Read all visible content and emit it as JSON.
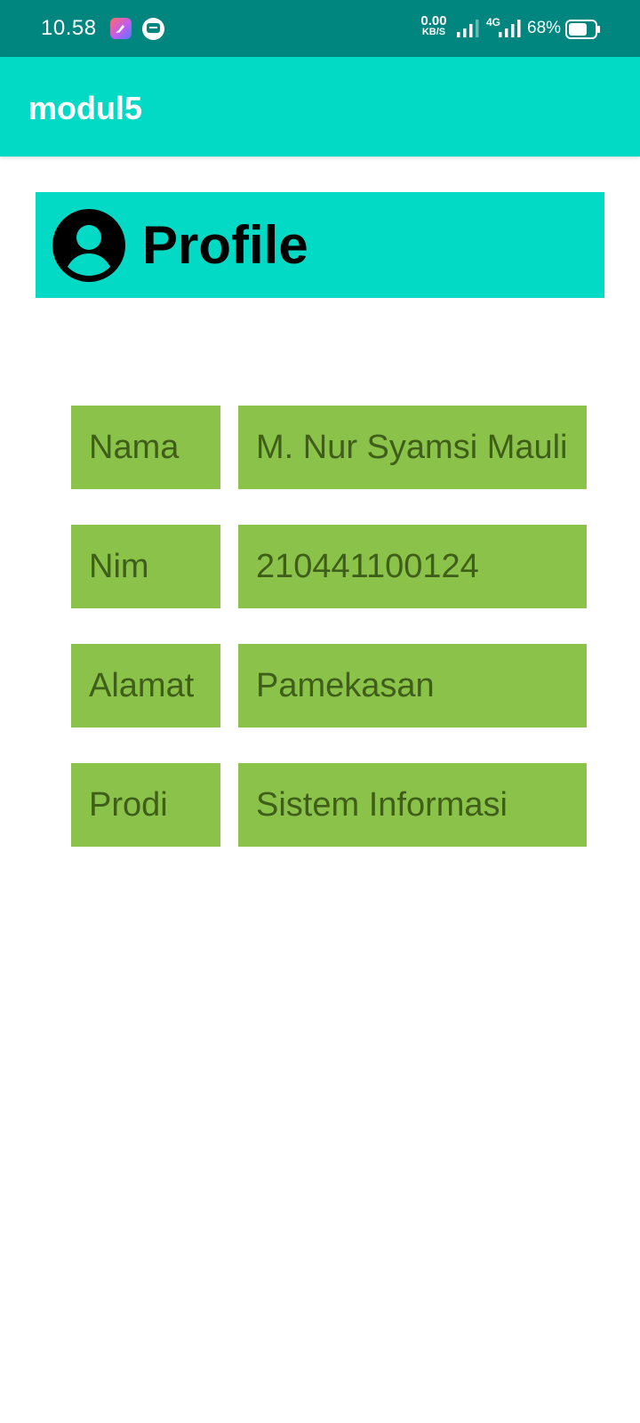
{
  "status_bar": {
    "time": "10.58",
    "net_speed_value": "0.00",
    "net_speed_unit": "KB/S",
    "network_type": "4G",
    "battery_percent": "68%",
    "icons": [
      "app-notification-icon",
      "message-notification-icon",
      "signal-icon",
      "signal-4g-icon",
      "battery-icon"
    ]
  },
  "app_bar": {
    "title": "modul5",
    "color": "#03dac5"
  },
  "profile": {
    "title": "Profile",
    "icon": "account-circle-icon"
  },
  "fields": [
    {
      "label": "Nama",
      "value": "M. Nur Syamsi Mauli"
    },
    {
      "label": "Nim",
      "value": "210441100124"
    },
    {
      "label": "Alamat",
      "value": "Pamekasan"
    },
    {
      "label": "Prodi",
      "value": "Sistem Informasi"
    }
  ],
  "colors": {
    "status_bar": "#00857f",
    "accent": "#03dac5",
    "field_bg": "#8bc34a",
    "field_text": "#3f5e1a"
  }
}
